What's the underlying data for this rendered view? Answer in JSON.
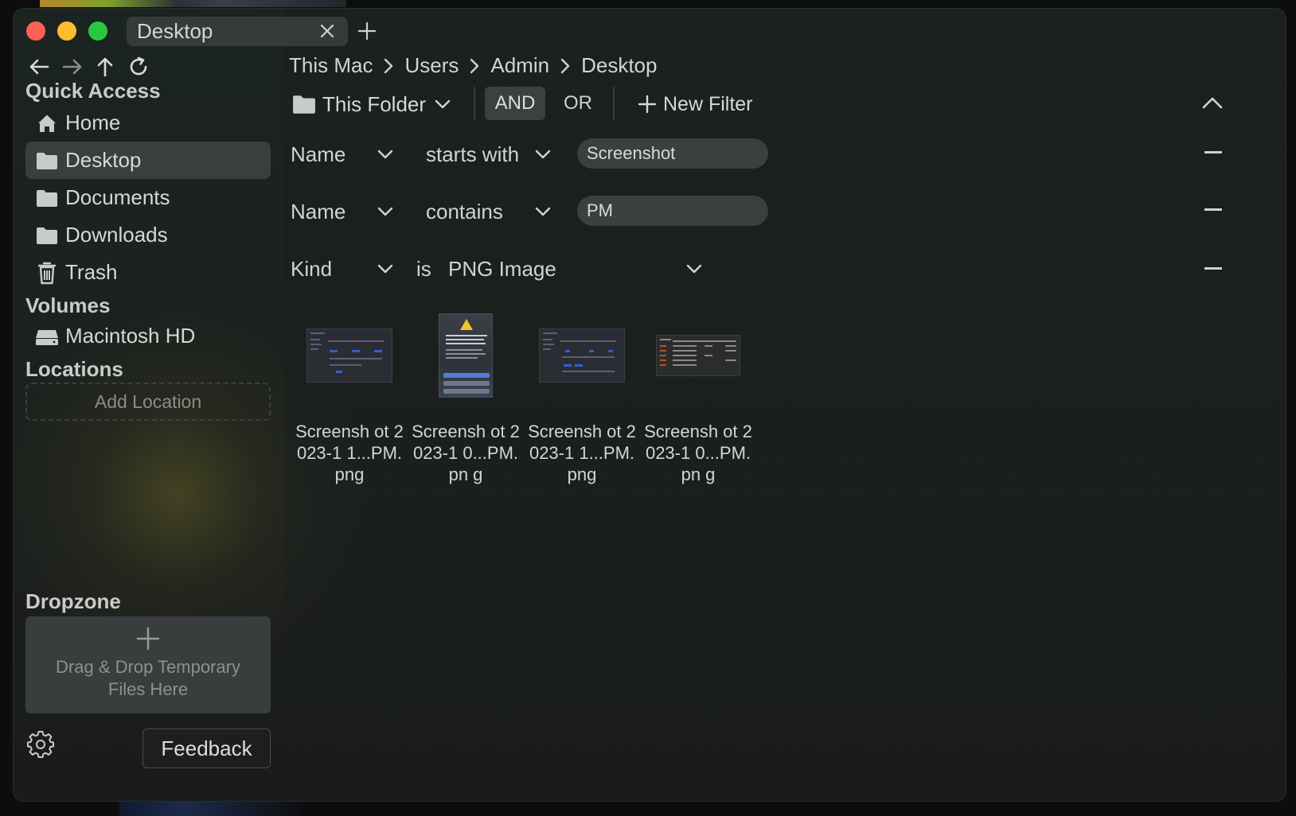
{
  "window": {
    "tab_title": "Desktop"
  },
  "breadcrumb": [
    "This Mac",
    "Users",
    "Admin",
    "Desktop"
  ],
  "sidebar": {
    "quick_access_title": "Quick Access",
    "quick_access": [
      {
        "label": "Home",
        "icon": "home-icon"
      },
      {
        "label": "Desktop",
        "icon": "folder-icon",
        "selected": true
      },
      {
        "label": "Documents",
        "icon": "folder-icon"
      },
      {
        "label": "Downloads",
        "icon": "folder-icon"
      },
      {
        "label": "Trash",
        "icon": "trash-icon"
      }
    ],
    "volumes_title": "Volumes",
    "volumes": [
      {
        "label": "Macintosh HD",
        "icon": "drive-icon"
      }
    ],
    "locations_title": "Locations",
    "add_location_label": "Add Location",
    "dropzone_title": "Dropzone",
    "dropzone_text": "Drag & Drop Temporary Files Here",
    "feedback_label": "Feedback"
  },
  "filter_bar": {
    "scope_label": "This Folder",
    "and_label": "AND",
    "or_label": "OR",
    "active_operator": "AND",
    "new_filter_label": "New Filter"
  },
  "filters": [
    {
      "attribute": "Name",
      "operator": "starts with",
      "value": "Screenshot"
    },
    {
      "attribute": "Name",
      "operator": "contains",
      "value": "PM"
    },
    {
      "attribute": "Kind",
      "operator": "is",
      "value": "PNG Image"
    }
  ],
  "files": [
    {
      "name": "Screensh ot 2023-1 1...PM.png"
    },
    {
      "name": "Screensh ot 2023-1 0...PM.pn g"
    },
    {
      "name": "Screensh ot 2023-1 1...PM.png"
    },
    {
      "name": "Screensh ot 2023-1 0...PM.pn g"
    }
  ],
  "colors": {
    "close": "#ff5f57",
    "minimize": "#febc2e",
    "maximize": "#28c840",
    "selected_item": "#3a3e3d"
  }
}
